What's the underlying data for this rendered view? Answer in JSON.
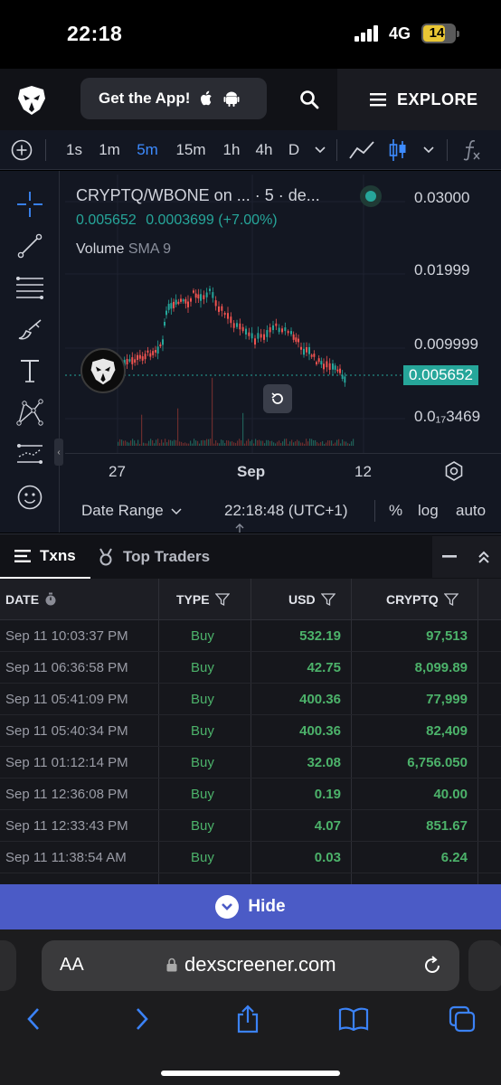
{
  "status": {
    "time": "22:18",
    "network": "4G",
    "battery": "14"
  },
  "header": {
    "get_app": "Get the App!",
    "explore": "EXPLORE"
  },
  "toolbar": {
    "intervals": [
      "1s",
      "1m",
      "5m",
      "15m",
      "1h",
      "4h",
      "D"
    ],
    "active_interval": "5m"
  },
  "chart": {
    "title": "CRYPTQ/WBONE on ... · 5 · de...",
    "price": "0.005652",
    "change": "0.0003699 (+7.00%)",
    "volume_label": "Volume",
    "sma_label": "SMA 9",
    "y_ticks": [
      "0.03000",
      "0.01999",
      "0.009999",
      "0.005652",
      "0.0₁₇3469"
    ],
    "x_ticks": [
      "27",
      "Sep",
      "12"
    ],
    "date_range": "Date Range",
    "clock": "22:18:48 (UTC+1)",
    "percent": "%",
    "log": "log",
    "auto": "auto",
    "colors": {
      "up": "#26a69a",
      "down": "#ef5350",
      "accent": "#3d8bff"
    }
  },
  "tabs": {
    "txns": "Txns",
    "top_traders": "Top Traders"
  },
  "table": {
    "headers": {
      "date": "DATE",
      "type": "TYPE",
      "usd": "USD",
      "token": "CRYPTQ"
    },
    "rows": [
      {
        "date": "Sep 11 10:03:37 PM",
        "type": "Buy",
        "usd": "532.19",
        "token": "97,513"
      },
      {
        "date": "Sep 11 06:36:58 PM",
        "type": "Buy",
        "usd": "42.75",
        "token": "8,099.89"
      },
      {
        "date": "Sep 11 05:41:09 PM",
        "type": "Buy",
        "usd": "400.36",
        "token": "77,999"
      },
      {
        "date": "Sep 11 05:40:34 PM",
        "type": "Buy",
        "usd": "400.36",
        "token": "82,409"
      },
      {
        "date": "Sep 11 01:12:14 PM",
        "type": "Buy",
        "usd": "32.08",
        "token": "6,756.050"
      },
      {
        "date": "Sep 11 12:36:08 PM",
        "type": "Buy",
        "usd": "0.19",
        "token": "40.00"
      },
      {
        "date": "Sep 11 12:33:43 PM",
        "type": "Buy",
        "usd": "4.07",
        "token": "851.67"
      },
      {
        "date": "Sep 11 11:38:54 AM",
        "type": "Buy",
        "usd": "0.03",
        "token": "6.24"
      },
      {
        "date": "",
        "type": "",
        "usd": "",
        "token": ""
      }
    ]
  },
  "hide": {
    "label": "Hide"
  },
  "safari": {
    "aa": "AA",
    "url": "dexscreener.com"
  }
}
